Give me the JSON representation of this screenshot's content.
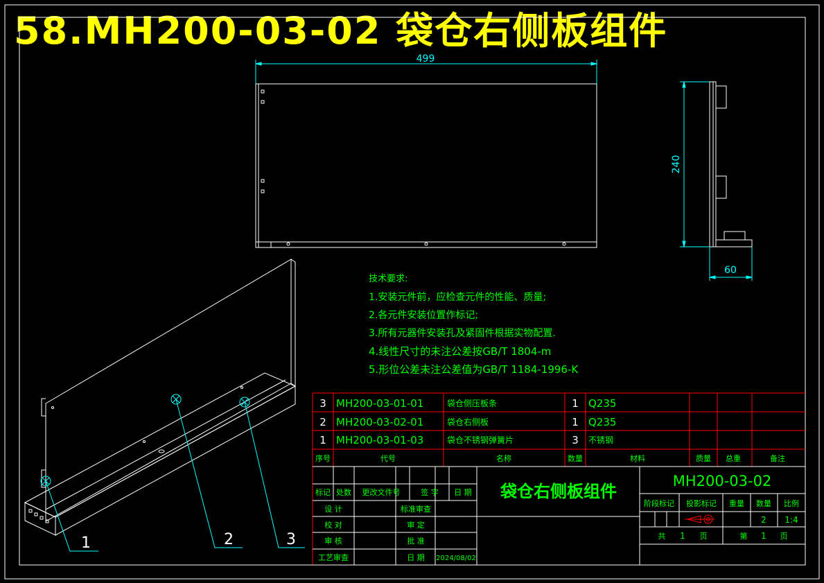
{
  "drawing": {
    "banner_title": "58.MH200-03-02 袋仓右侧板组件",
    "dimensions": {
      "width": "499",
      "height": "240",
      "depth": "60"
    },
    "balloons": [
      "1",
      "2",
      "3"
    ],
    "colors": {
      "background": "#000000",
      "outline": "#ffffff",
      "dimension": "#00ffff",
      "text": "#00ff00",
      "banner": "#ffff00",
      "table_line": "#ff0000"
    }
  },
  "technical_requirements": {
    "heading": "技术要求:",
    "items": [
      "1.安装元件前，应检查元件的性能、质量;",
      "2.各元件安装位置作标记;",
      "3.所有元器件安装孔及紧固件根据实物配置.",
      "4.线性尺寸的未注公差按GB/T 1804-m",
      "5.形位公差未注公差值为GB/T 1184-1996-K"
    ]
  },
  "bom": {
    "rows": [
      {
        "index": "3",
        "code": "MH200-03-01-01",
        "name": "袋仓侧压板条",
        "qty": "1",
        "material": "Q235"
      },
      {
        "index": "2",
        "code": "MH200-03-02-01",
        "name": "袋仓右侧板",
        "qty": "1",
        "material": "Q235"
      },
      {
        "index": "1",
        "code": "MH200-03-01-03",
        "name": "袋仓不锈钢弹簧片",
        "qty": "3",
        "material": "不锈钢"
      }
    ],
    "headers": {
      "index": "序号",
      "code": "代号",
      "name": "名称",
      "qty": "数量",
      "material": "材料",
      "unit_weight": "质量",
      "total_weight": "总重",
      "remark": "备注"
    }
  },
  "title_block": {
    "part_name": "袋仓右侧板组件",
    "drawing_number": "MH200-03-02",
    "rev_headers": [
      "标记",
      "处数",
      "更改文件号",
      "签 字",
      "日 期"
    ],
    "roles_left": [
      "设 计",
      "校 对",
      "审 核",
      "工艺审查"
    ],
    "roles_right": [
      "标准审查",
      "审 定",
      "批 准",
      "日 期"
    ],
    "date": "2024/08/02",
    "attr_headers": [
      "阶段标记",
      "投影标记",
      "重量",
      "数量",
      "比例"
    ],
    "quantity": "2",
    "scale": "1:4",
    "total_sheets_label": "共",
    "total_sheets": "1",
    "sheet_label": "第",
    "sheet_no": "1",
    "page_unit": "页"
  }
}
